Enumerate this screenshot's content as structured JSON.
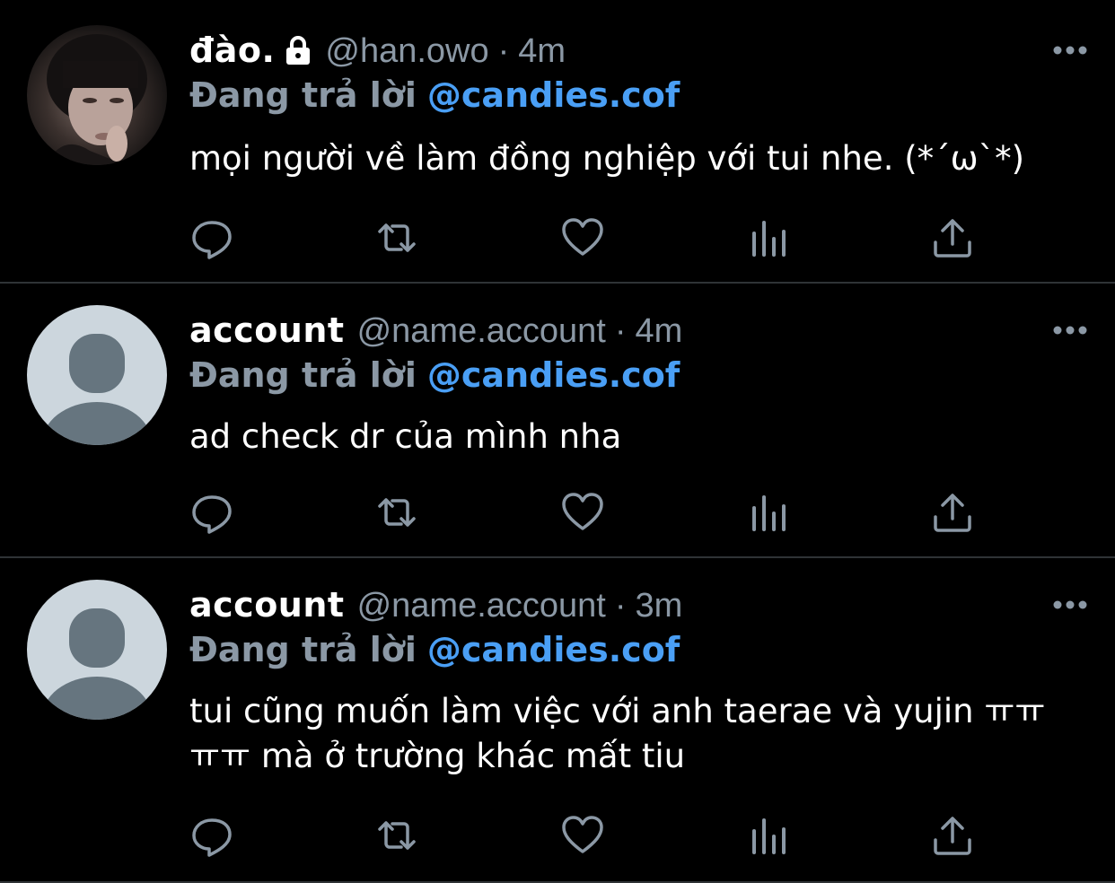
{
  "tweets": [
    {
      "name": "đào.",
      "handle": "@han.owo",
      "dot": "·",
      "time": "4m",
      "reply_prefix": "Đang trả lời",
      "reply_to": "@candies.cof",
      "text": "mọi người về làm đồng nghiệp với tui nhe.  (*´ω`*)",
      "avatar": "photo",
      "locked": true
    },
    {
      "name": "account",
      "handle": "@name.account",
      "dot": "·",
      "time": "4m",
      "reply_prefix": "Đang trả lời",
      "reply_to": "@candies.cof",
      "text": "ad check dr của mình nha",
      "avatar": "default",
      "locked": false
    },
    {
      "name": "account",
      "handle": "@name.account",
      "dot": "·",
      "time": "3m",
      "reply_prefix": "Đang trả lời",
      "reply_to": "@candies.cof",
      "text": "tui cũng muốn làm việc với anh taerae và yujin ㅠㅠ ㅠㅠ mà ở trường khác mất tiu",
      "avatar": "default",
      "locked": false
    }
  ],
  "icons": {
    "reply": "reply-icon",
    "retweet": "retweet-icon",
    "like": "heart-icon",
    "views": "views-icon",
    "share": "share-icon",
    "more": "more-icon",
    "lock": "lock-icon"
  },
  "colors": {
    "background": "#000000",
    "divider": "#2f3336",
    "muted": "#8b98a5",
    "link": "#4a9ff5",
    "text": "#ffffff"
  }
}
